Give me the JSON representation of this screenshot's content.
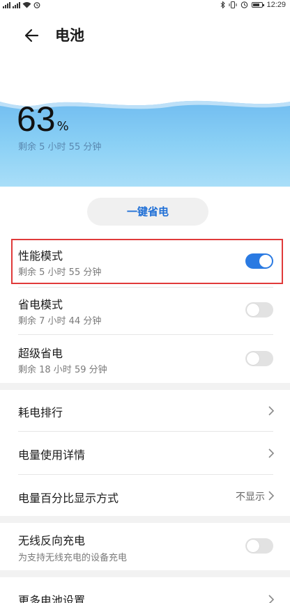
{
  "status_bar": {
    "time": "12:29",
    "left_icons": [
      "sim-signal-icon",
      "sim-signal-icon",
      "wifi-icon",
      "alarm-icon"
    ],
    "right_icons": [
      "bluetooth-icon",
      "vibrate-icon",
      "nfc-icon",
      "battery-icon"
    ]
  },
  "header": {
    "back_icon": "back-arrow-icon",
    "title": "电池"
  },
  "battery": {
    "percent": "63",
    "percent_unit": "%",
    "remaining": "剩余 5 小时 55 分钟",
    "level_fraction": 0.63
  },
  "onekey_button": {
    "label": "一键省电"
  },
  "modes": [
    {
      "title": "性能模式",
      "subtitle": "剩余 5 小时 55 分钟",
      "enabled": true
    },
    {
      "title": "省电模式",
      "subtitle": "剩余 7 小时 44 分钟",
      "enabled": false
    },
    {
      "title": "超级省电",
      "subtitle": "剩余 18 小时 59 分钟",
      "enabled": false
    }
  ],
  "menu": [
    {
      "title": "耗电排行",
      "value": ""
    },
    {
      "title": "电量使用详情",
      "value": ""
    },
    {
      "title": "电量百分比显示方式",
      "value": "不显示"
    }
  ],
  "wireless": {
    "title": "无线反向充电",
    "subtitle": "为支持无线充电的设备充电",
    "enabled": false
  },
  "more": {
    "title": "更多电池设置"
  },
  "colors": {
    "accent": "#2a7ae2",
    "highlight_border": "#e03a3a",
    "hero_top": "#6bb8ef",
    "hero_bottom": "#a9def8"
  }
}
